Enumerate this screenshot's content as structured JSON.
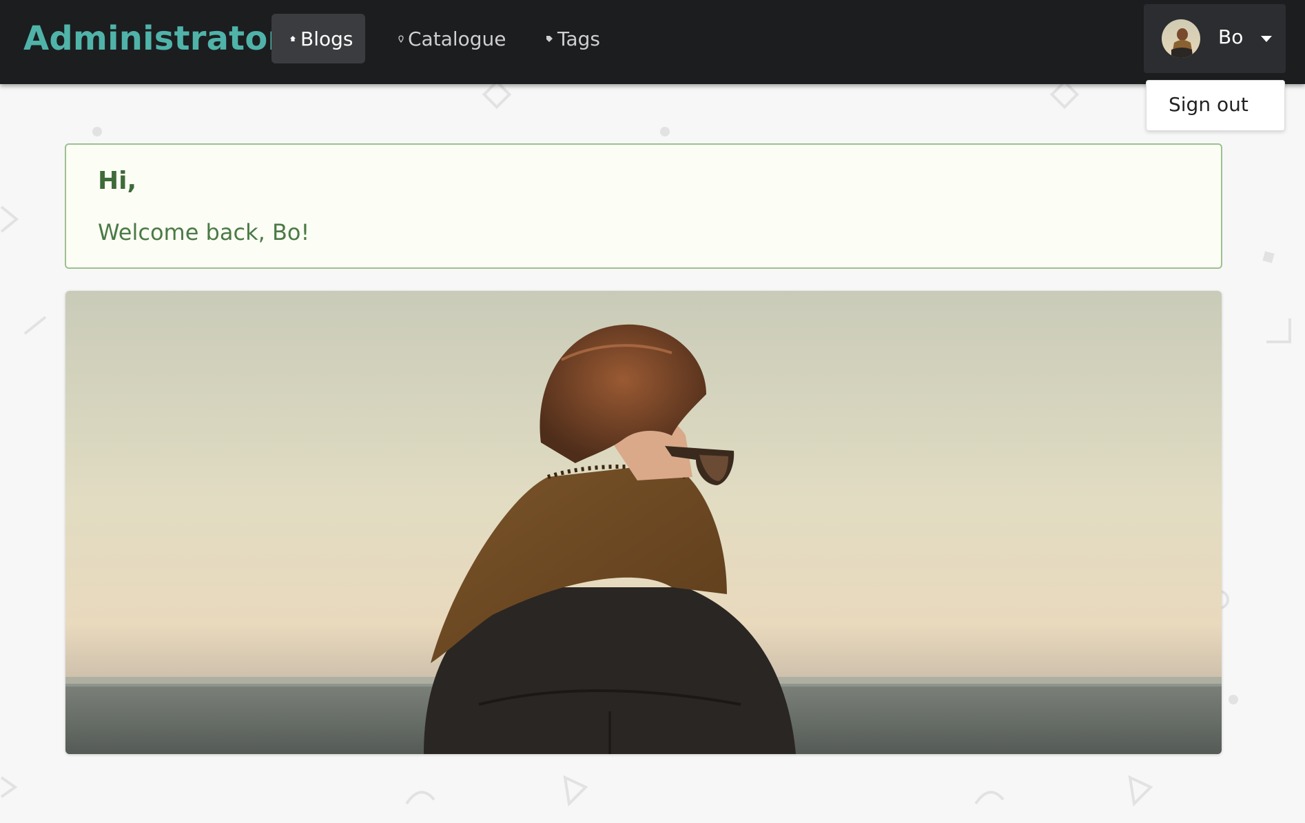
{
  "brand": "Administrator",
  "nav": {
    "items": [
      {
        "label": "Blogs",
        "icon": "home-icon",
        "active": true
      },
      {
        "label": "Catalogue",
        "icon": "pin-icon",
        "active": false
      },
      {
        "label": "Tags",
        "icon": "tag-icon",
        "active": false
      }
    ]
  },
  "user": {
    "name": "Bo",
    "menu": {
      "sign_out": "Sign out"
    }
  },
  "welcome": {
    "title": "Hi,",
    "message": "Welcome back, Bo!"
  },
  "colors": {
    "brand": "#4fb3a9",
    "navbar": "#1c1d1f",
    "welcome_border": "#9cc08f",
    "welcome_text": "#3f6a3a"
  }
}
